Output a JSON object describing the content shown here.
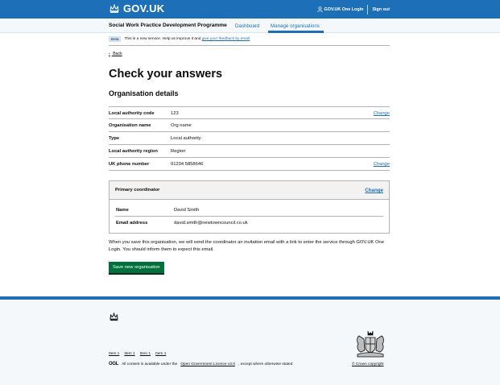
{
  "header": {
    "logo_text": "GOV.UK",
    "one_login": "GOV.UK One Login",
    "sign_out": "Sign out"
  },
  "service_nav": {
    "service_name": "Social Work Practice Development Programme",
    "links": [
      "Dashboard",
      "Manage organisations"
    ],
    "active": "Manage organisations"
  },
  "phase_banner": {
    "tag": "Beta",
    "text": "This is a new service. Help us improve it and",
    "link": "give your feedback by email"
  },
  "back_link": "Back",
  "page_title": "Check your answers",
  "section_title": "Organisation details",
  "summary": [
    {
      "key": "Local authority code",
      "value": "123",
      "action": "Change"
    },
    {
      "key": "Organisation name",
      "value": "Org name",
      "action": ""
    },
    {
      "key": "Type",
      "value": "Local authority",
      "action": ""
    },
    {
      "key": "Local authority region",
      "value": "Region",
      "action": ""
    },
    {
      "key": "UK phone number",
      "value": "01234 5858646",
      "action": "Change"
    }
  ],
  "coordinator_card": {
    "title": "Primary coordinator",
    "action": "Change",
    "rows": [
      {
        "key": "Name",
        "value": "David Smith"
      },
      {
        "key": "Email address",
        "value": "david.smith@newtowncouncil.co.uk"
      }
    ]
  },
  "info_text": "When you save this organisation, we will send the coordinator an invitation email with a link to enter the service through GOV.UK One Login. You should inform them to expect this email.",
  "save_button": "Save new organisation",
  "footer": {
    "links": [
      "Item 1",
      "Item 1",
      "Item 1",
      "Item 1"
    ],
    "ogl": "OGL",
    "licence_prefix": "All content is available under the",
    "licence_link": "Open Government Licence v3.0",
    "licence_suffix": ", except where otherwise stated",
    "copyright": "© Crown copyright"
  },
  "colors": {
    "brand_blue": "#1d70b8",
    "button_green": "#00703c",
    "link_blue": "#1d70b8"
  }
}
